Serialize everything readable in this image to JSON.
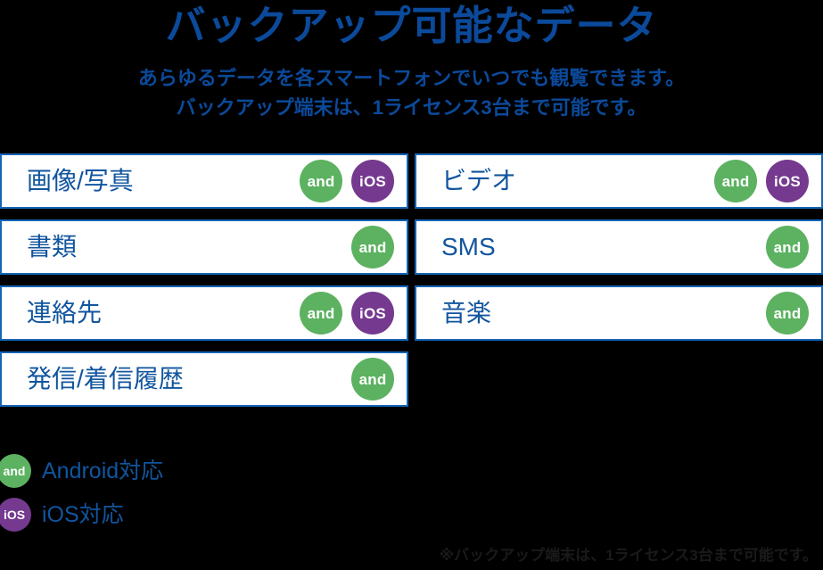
{
  "header": {
    "title": "バックアップ可能なデータ",
    "subtitle_lines": [
      "あらゆるデータを各スマートフォンでいつでも観覧できます。",
      "バックアップ端末は、1ライセンス3台まで可能です。"
    ]
  },
  "badges": {
    "android_label": "and",
    "ios_label": "iOS",
    "android_color": "#5cb261",
    "ios_color": "#75398f"
  },
  "colors": {
    "title_blue": "#0b4a9b",
    "card_text_blue": "#11559e",
    "card_border_blue": "#1565b5",
    "background": "#000000",
    "card_background": "#ffffff",
    "footnote_text": "#1a1a1a"
  },
  "grid": {
    "rows": [
      {
        "left": {
          "label": "画像/写真",
          "android": true,
          "ios": true
        },
        "right": {
          "label": "ビデオ",
          "android": true,
          "ios": true
        }
      },
      {
        "left": {
          "label": "書類",
          "android": true,
          "ios": false
        },
        "right": {
          "label": "SMS",
          "android": true,
          "ios": false
        }
      },
      {
        "left": {
          "label": "連絡先",
          "android": true,
          "ios": true
        },
        "right": {
          "label": "音楽",
          "android": true,
          "ios": false
        }
      },
      {
        "left": {
          "label": "発信/着信履歴",
          "android": true,
          "ios": false
        },
        "right": null
      }
    ]
  },
  "legend": {
    "items": [
      {
        "badge": "and",
        "type": "android",
        "label": "Android対応"
      },
      {
        "badge": "iOS",
        "type": "ios",
        "label": "iOS対応"
      }
    ]
  },
  "footnote": {
    "text": "※バックアップ端末は、1ライセンス3台まで可能です。"
  }
}
